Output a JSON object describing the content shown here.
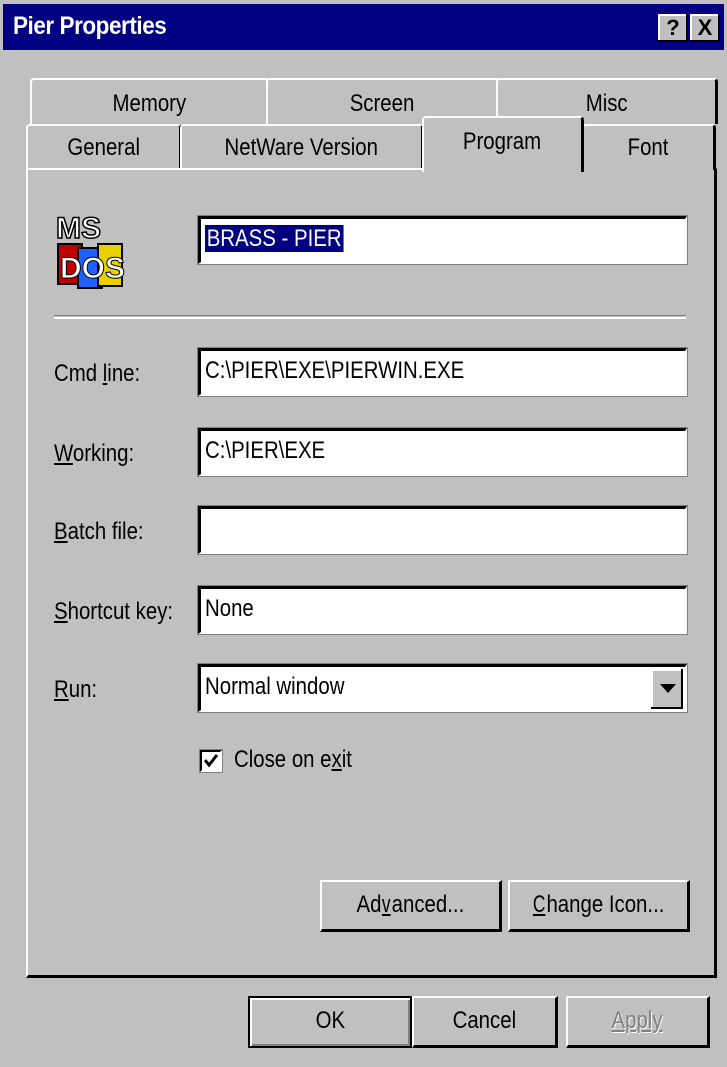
{
  "window": {
    "title": "Pier Properties",
    "help_btn": "?",
    "close_btn": "X"
  },
  "tabs": {
    "row1": [
      "Memory",
      "Screen",
      "Misc"
    ],
    "row2": [
      "General",
      "NetWare Version",
      "Program",
      "Font"
    ],
    "active": "Program"
  },
  "program": {
    "icon_name": "ms-dos-icon",
    "icon_text_top": "MS",
    "icon_text_bottom": "DOS",
    "title_value": "BRASS - PIER",
    "cmd_line_label": "Cmd line:",
    "cmd_line_value": "C:\\PIER\\EXE\\PIERWIN.EXE",
    "working_label": "Working:",
    "working_value": "C:\\PIER\\EXE",
    "batch_label": "Batch file:",
    "batch_value": "",
    "shortcut_label": "Shortcut key:",
    "shortcut_value": "None",
    "run_label": "Run:",
    "run_value": "Normal window",
    "close_on_exit_label": "Close on exit",
    "close_on_exit_checked": true,
    "advanced_label": "Advanced...",
    "change_icon_label": "Change Icon..."
  },
  "footer": {
    "ok": "OK",
    "cancel": "Cancel",
    "apply": "Apply"
  }
}
